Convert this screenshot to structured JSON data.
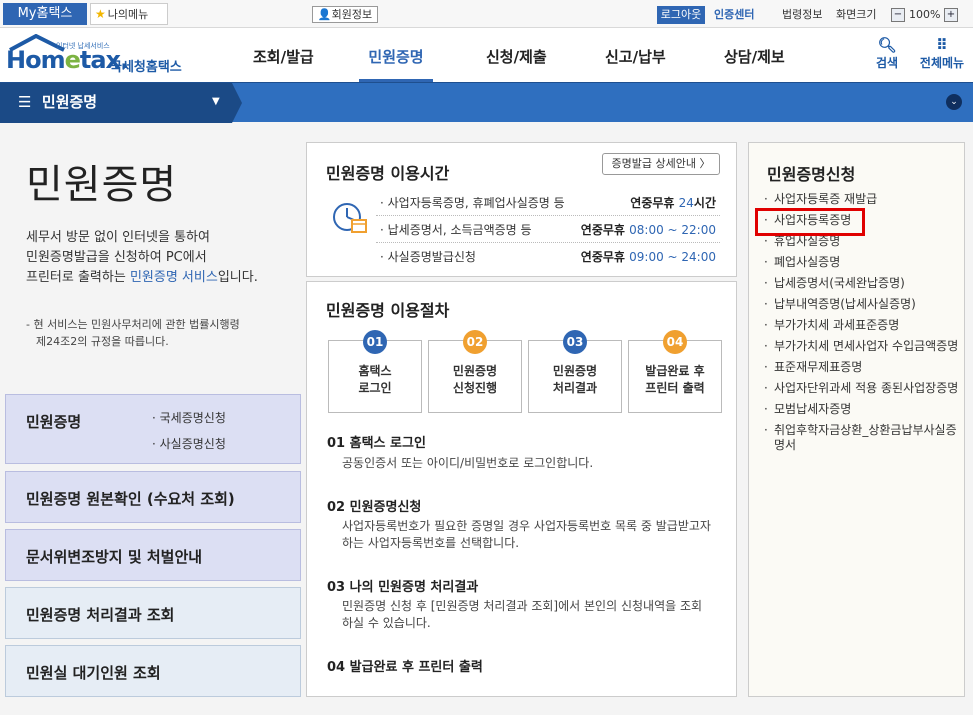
{
  "utility": {
    "my_hometax": "My홈택스",
    "my_menu": "나의메뉴",
    "member_info": "회원정보",
    "logout": "로그아웃",
    "cert_center": "인증센터",
    "law_info": "법령정보",
    "screen_size": "화면크기",
    "zoom": "100%",
    "zoom_minus": "−",
    "zoom_plus": "+"
  },
  "header": {
    "logo_small": "인터넷 납세서비스",
    "logo_main_a": "Hom",
    "logo_main_e": "e",
    "logo_main_b": "tax.",
    "logo_sub": "국세청홈택스",
    "nav": [
      "조회/발급",
      "민원증명",
      "신청/제출",
      "신고/납부",
      "상담/제보"
    ],
    "search": "검색",
    "all_menu": "전체메뉴"
  },
  "bluebar": {
    "title": "민원증명"
  },
  "left": {
    "title": "민원증명",
    "desc_line1": "세무서 방문 없이 인터넷을 통하여",
    "desc_line2": "민원증명발급을 신청하여 PC에서",
    "desc_line3a": "프린터로 출력하는 ",
    "desc_line3b": "민원증명 서비스",
    "desc_line3c": "입니다.",
    "note_line1": "- 현 서비스는 민원사무처리에 관한 법률시행령",
    "note_line2": "제24조2의 규정을 따릅니다.",
    "boxes": [
      {
        "title": "민원증명",
        "subs": [
          "· 국세증명신청",
          "· 사실증명신청"
        ]
      },
      {
        "title": "민원증명 원본확인 (수요처 조회)"
      },
      {
        "title": "문서위변조방지 및 처벌안내"
      },
      {
        "title": "민원증명 처리결과 조회"
      },
      {
        "title": "민원실 대기인원 조회"
      }
    ]
  },
  "usage_time": {
    "title": "민원증명 이용시간",
    "detail_btn": "증명발급 상세안내 〉",
    "rows": [
      {
        "label": "· 사업자등록증명, 휴폐업사실증명 등",
        "prefix": "연중무휴 ",
        "hi": "24",
        "suffix": "시간"
      },
      {
        "label": "· 납세증명서, 소득금액증명 등",
        "prefix": "연중무휴 ",
        "hi": "08:00 ~ 22:00",
        "suffix": ""
      },
      {
        "label": "· 사실증명발급신청",
        "prefix": "연중무휴 ",
        "hi": "09:00 ~ 24:00",
        "suffix": ""
      }
    ]
  },
  "procedure": {
    "title": "민원증명 이용절차",
    "steps": [
      {
        "num": "01",
        "line1": "홈택스",
        "line2": "로그인"
      },
      {
        "num": "02",
        "line1": "민원증명",
        "line2": "신청진행"
      },
      {
        "num": "03",
        "line1": "민원증명",
        "line2": "처리결과"
      },
      {
        "num": "04",
        "line1": "발급완료 후",
        "line2": "프린터 출력"
      }
    ],
    "items": [
      {
        "h": "01 홈택스 로그인",
        "d1": "공동인증서 또는 아이디/비밀번호로 로그인합니다.",
        "d2": ""
      },
      {
        "h": "02 민원증명신청",
        "d1": "사업자등록번호가 필요한 증명일 경우 사업자등록번호 목록 중 발급받고자",
        "d2": "하는 사업자등록번호를 선택합니다."
      },
      {
        "h": "03 나의 민원증명 처리결과",
        "d1": "민원증명 신청 후 [민원증명 처리결과 조회]에서 본인의 신청내역을 조회",
        "d2": "하실 수 있습니다."
      },
      {
        "h": "04 발급완료 후 프린터 출력",
        "d1": "",
        "d2": ""
      }
    ]
  },
  "right": {
    "title": "민원증명신청",
    "items": [
      "사업자등록증 재발급",
      "사업자등록증명",
      "휴업사실증명",
      "폐업사실증명",
      "납세증명서(국세완납증명)",
      "납부내역증명(납세사실증명)",
      "부가가치세 과세표준증명",
      "부가가치세 면세사업자 수입금액증명",
      "표준재무제표증명",
      "사업자단위과세 적용 종된사업장증명",
      "모범납세자증명",
      "취업후학자금상환_상환금납부사실증명서"
    ]
  },
  "colors": {
    "brand_blue": "#2f66b3",
    "step_blue": "#2f66b3",
    "step_orange": "#f0a030",
    "highlight": "#e00000"
  }
}
